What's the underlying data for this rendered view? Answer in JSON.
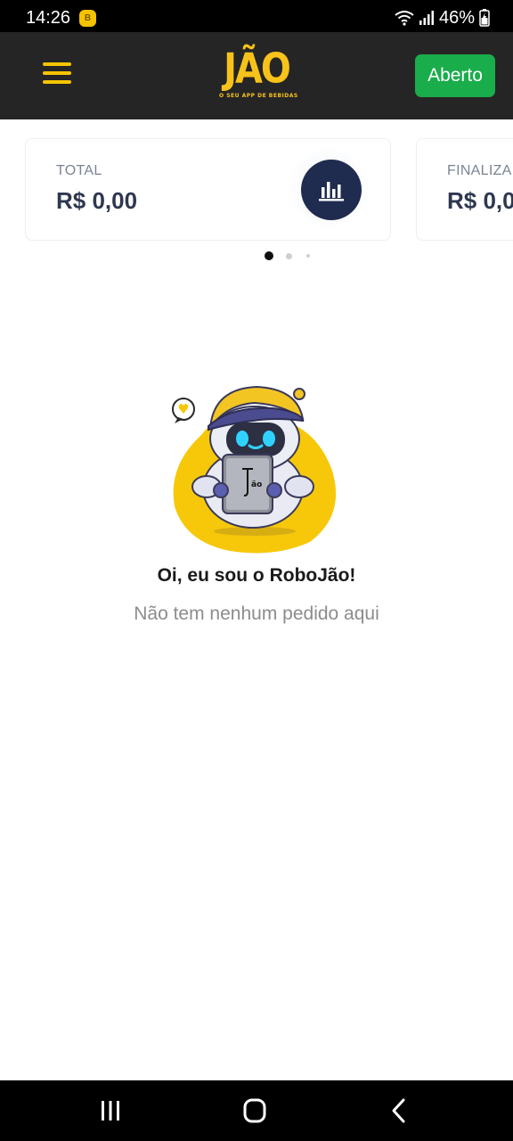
{
  "status_bar": {
    "time": "14:26",
    "notification_badge": "B",
    "battery_percent": "46%",
    "icons": [
      "wifi-icon",
      "signal-icon",
      "battery-icon"
    ]
  },
  "header": {
    "menu_icon": "hamburger-menu-icon",
    "logo_text": "JÃO",
    "logo_tagline": "O SEU APP DE BEBIDAS",
    "store_status": "Aberto",
    "colors": {
      "background": "#252525",
      "accent": "#f5c400",
      "status_green": "#1aad4b"
    }
  },
  "summary_cards": [
    {
      "label": "TOTAL",
      "value": "R$ 0,00",
      "icon": "bar-chart-icon"
    },
    {
      "label": "FINALIZA",
      "value": "R$ 0,0"
    }
  ],
  "pager": {
    "page_count": 3,
    "active_index": 0
  },
  "empty_state": {
    "illustration": "robojao-mascot-icon",
    "title": "Oi, eu sou o RoboJão!",
    "subtitle": "Não tem nenhum pedido aqui"
  },
  "nav_bar": {
    "buttons": [
      "recent-apps-icon",
      "home-icon",
      "back-icon"
    ]
  }
}
